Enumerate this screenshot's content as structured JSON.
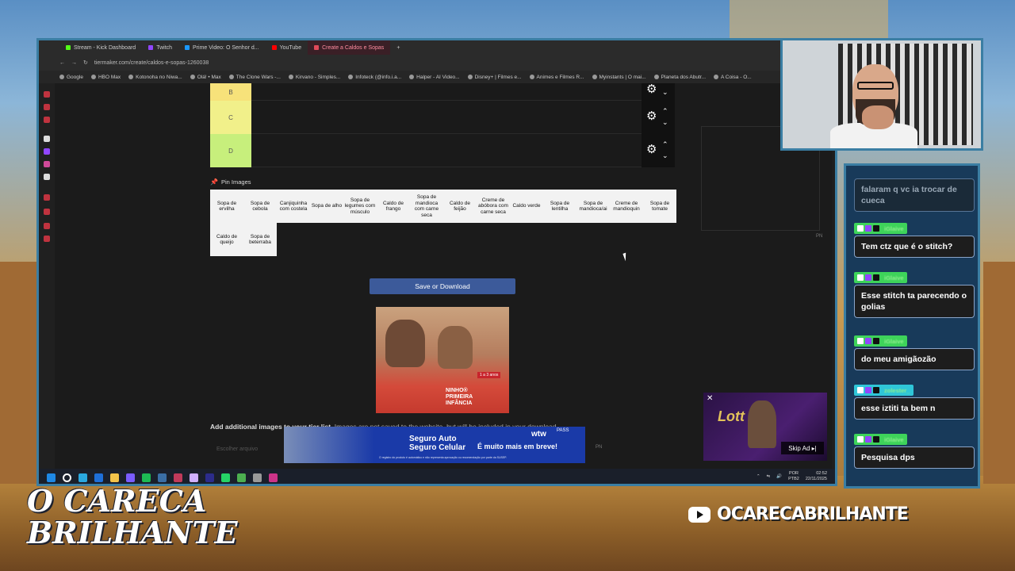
{
  "overlay": {
    "logo_line1": "O CARECA",
    "logo_line2": "BRILHANTE",
    "youtube_handle": "OCARECABRILHANTE"
  },
  "browser": {
    "tabs": [
      {
        "label": "Stream - Kick Dashboard",
        "color": "#53fc18"
      },
      {
        "label": "Twitch",
        "color": "#9146ff"
      },
      {
        "label": "Prime Video: O Senhor d...",
        "color": "#1a98ff"
      },
      {
        "label": "YouTube",
        "color": "#ff0000"
      },
      {
        "label": "Create a Caldos e Sopas",
        "color": "#e04a5a",
        "active": true
      }
    ],
    "url": "tiermaker.com/create/caldos-e-sopas-1260038",
    "bookmarks": [
      "Google",
      "HBO Max",
      "Kotonoha no Niwa...",
      "Olá! • Max",
      "The Clone Wars -...",
      "Kirvano - Simples...",
      "Infoteck (@info.i.a...",
      "Halper - AI Video...",
      "Disney+ | Filmes e...",
      "Animes e Filmes R...",
      "Myinstants | O mai...",
      "Planeta dos Abutr...",
      "A Coisa - O..."
    ]
  },
  "tierlist": {
    "rows": [
      {
        "label": "B",
        "color": "#f7e27a"
      },
      {
        "label": "C",
        "color": "#f1f08a"
      },
      {
        "label": "D",
        "color": "#c7ef7c"
      }
    ],
    "pin_title": "Pin Images",
    "pin_items": [
      "Sopa de ervilha",
      "Sopa de cebola",
      "Canjiquinha com costela",
      "Sopa de alho",
      "Sopa de legumes com músculo",
      "Caldo de frango",
      "Sopa de mandioca com carne seca",
      "Caldo de feijão",
      "Creme de abóbora com carne seca",
      "Caldo verde",
      "Sopa de lentilha",
      "Sopa de mandioca/ai",
      "Creme de mandioquin",
      "Sopa de tomate",
      "Caldo de queijo",
      "Sopa de beterraba"
    ],
    "save_label": "Save or Download",
    "add_note_bold": "Add additional images to your tier list.",
    "add_note_rest": " Images are not saved to the website, but will be included in your download.",
    "search_placeholder": "Escolher arquivo",
    "pn": "PN"
  },
  "ads": {
    "ninho_line1": "NINHO®",
    "ninho_line2": "PRIMEIRA",
    "ninho_line3": "INFÂNCIA",
    "ninho_badge": "1 a 3 anos",
    "bottom_title1": "Seguro Auto",
    "bottom_title2": "Seguro Celular",
    "bottom_cta": "É muito mais em breve!",
    "bottom_brand": "wtw",
    "bottom_pass": "PASS",
    "bottom_fine": "O registro do produto é automático e não representa aprovação ou recomendação por parte da SUSEP.",
    "video_brand": "Lott",
    "skip_label": "Skip Ad ▸|"
  },
  "taskbar": {
    "lang1": "POR",
    "lang2": "PTB2",
    "time": "02:52",
    "date": "22/11/2025"
  },
  "chat": [
    {
      "user": "iGlaive",
      "text": "falaram q vc ia trocar de cueca",
      "faded": true
    },
    {
      "user": "iGlaive",
      "text": "Tem ctz que é o stitch?"
    },
    {
      "user": "iGlaive",
      "text": "Esse stitch ta parecendo o golias"
    },
    {
      "user": "iGlaive",
      "text": "do meu amigãozão"
    },
    {
      "user": "zolester_",
      "text": "esse iztiti ta bem n",
      "alt": true
    },
    {
      "user": "iGlaive",
      "text": "Pesquisa dps"
    }
  ],
  "colors": {
    "accent": "#3b7ea3",
    "save_button": "#3c5a9a",
    "chat_badge": "#3ed35a"
  }
}
